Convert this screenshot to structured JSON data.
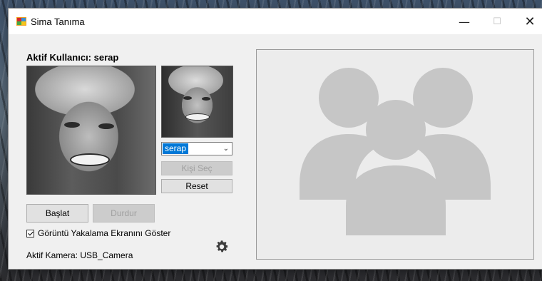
{
  "window": {
    "title": "Sima Tanıma",
    "icon": "app-window-icon",
    "controls": {
      "minimize": "—",
      "maximize": "☐",
      "close": "✕"
    }
  },
  "main": {
    "active_user_label": "Aktif Kullanıcı: serap",
    "person_select": {
      "selected": "serap"
    },
    "buttons": {
      "select_person": "Kişi Seç",
      "reset": "Reset",
      "start": "Başlat",
      "stop": "Durdur"
    },
    "show_capture_checkbox": {
      "label": "Görüntü Yakalama Ekranını Göster",
      "checked": true
    },
    "camera_label": "Aktif Kamera: USB_Camera",
    "settings_icon": "gear-icon",
    "preview_icon": "users-group-icon"
  },
  "colors": {
    "selection": "#0078d7",
    "placeholder_icon": "#c6c6c6"
  }
}
